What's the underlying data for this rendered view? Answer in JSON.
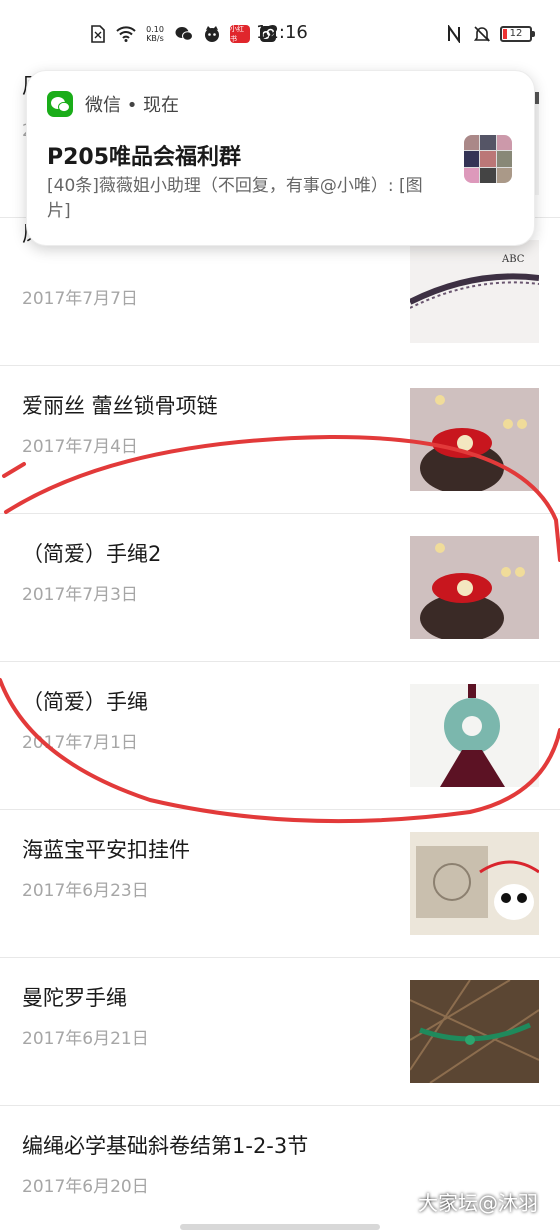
{
  "status_bar": {
    "speed_value": "0.10",
    "speed_unit": "KB/s",
    "red_app_badge": "小红书",
    "time": "12:16",
    "battery": "12"
  },
  "notification": {
    "app_label": "微信 • 现在",
    "title": "P205唯品会福利群",
    "body": "[40条]薇薇姐小助理（不回复，有事@小唯）: [图片]"
  },
  "list": {
    "items": [
      {
        "title": "凤冠",
        "date": "2017年7月7日",
        "thumb": "red-tassel"
      },
      {
        "title": "爱丽丝 蕾丝锁骨项链",
        "date": "2017年7月4日",
        "thumb": "lace-choker"
      },
      {
        "title": "（简爱）手绳2",
        "date": "2017年7月3日",
        "thumb": "red-bracelet-pinecone"
      },
      {
        "title": "（简爱）手绳",
        "date": "2017年7月1日",
        "thumb": "red-bracelet-pinecone"
      },
      {
        "title": "海蓝宝平安扣挂件",
        "date": "2017年6月23日",
        "thumb": "aquamarine-pendant"
      },
      {
        "title": "曼陀罗手绳",
        "date": "2017年6月21日",
        "thumb": "mandala-bracelet"
      },
      {
        "title": "编绳必学基础斜卷结第1-2-3节",
        "date": "2017年6月20日",
        "thumb": "green-cord-knots"
      }
    ]
  },
  "watermark": "大家坛@沐羽",
  "colors": {
    "annotation_stroke": "#e23a3a",
    "wechat_green": "#1aad19",
    "date_gray": "#a6a6a6"
  }
}
